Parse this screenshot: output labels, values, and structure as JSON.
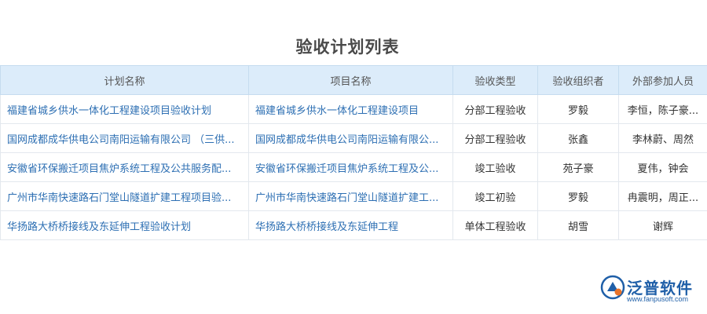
{
  "page": {
    "title": "验收计划列表"
  },
  "table": {
    "headers": [
      "计划名称",
      "项目名称",
      "验收类型",
      "验收组织者",
      "外部参加人员"
    ],
    "rows": [
      [
        "福建省城乡供水一体化工程建设项目验收计划",
        "福建省城乡供水一体化工程建设项目",
        "分部工程验收",
        "罗毅",
        "李恒，陈子豪..."
      ],
      [
        "国网成都成华供电公司南阳运输有限公司 （三供...",
        "国网成都成华供电公司南阳运输有限公...",
        "分部工程验收",
        "张鑫",
        "李林蔚、周然"
      ],
      [
        "安徽省环保搬迁项目焦炉系统工程及公共服务配...",
        "安徽省环保搬迁项目焦炉系统工程及公...",
        "竣工验收",
        "苑子豪",
        "夏伟，钟会"
      ],
      [
        "广州市华南快速路石门堂山隧道扩建工程项目验...",
        "广州市华南快速路石门堂山隧道扩建工...",
        "竣工初验",
        "罗毅",
        "冉震明，周正..."
      ],
      [
        "华扬路大桥桥接线及东延伸工程验收计划",
        "华扬路大桥桥接线及东延伸工程",
        "单体工程验收",
        "胡雪",
        "谢辉"
      ]
    ]
  },
  "watermark": {
    "name": "泛普软件",
    "url": "www.fanpusoft.com",
    "logo_icon": "fanpu-logo-icon"
  },
  "colors": {
    "header_bg": "#dcecfa",
    "link": "#2d6fb3",
    "brand": "#1f5fa8",
    "accent": "#e8732a"
  }
}
